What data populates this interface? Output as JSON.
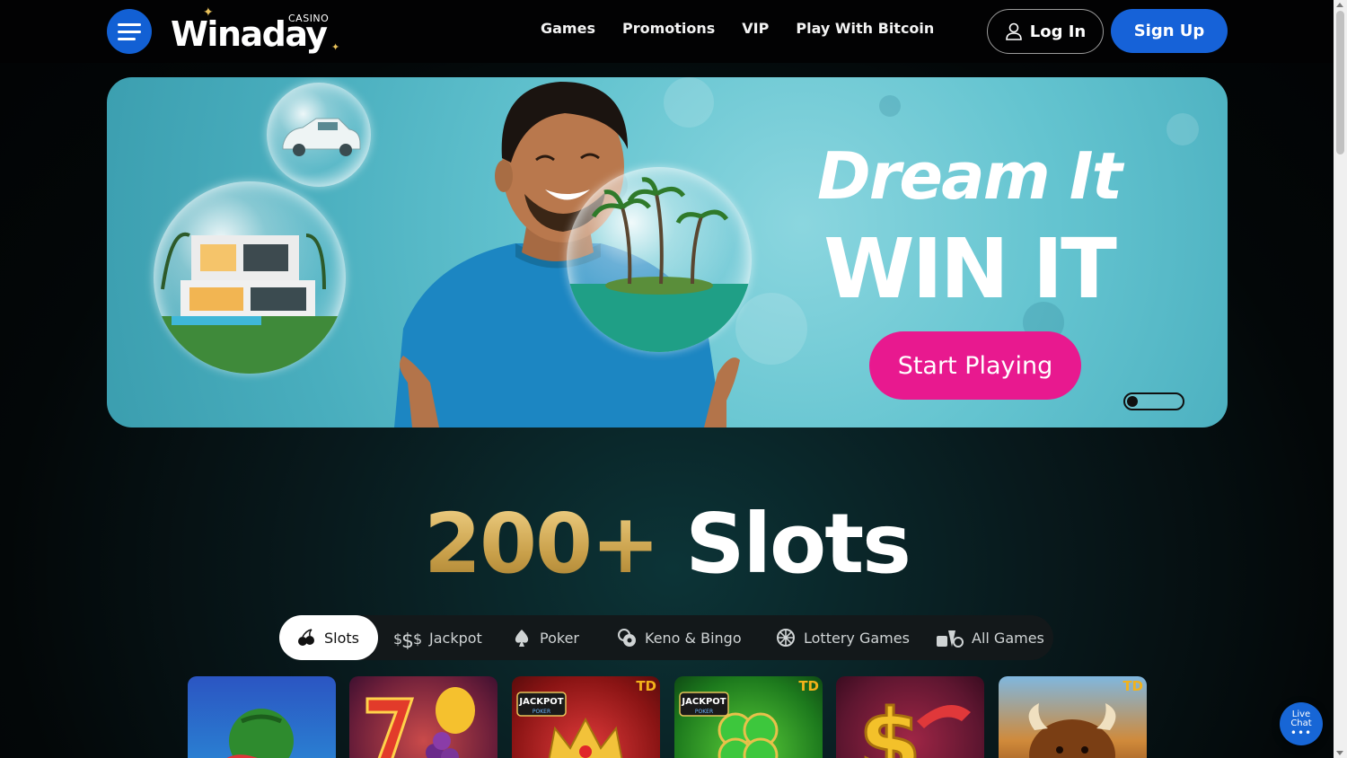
{
  "header": {
    "logo_text": "Winaday",
    "logo_tag": "CASINO",
    "nav": [
      "Games",
      "Promotions",
      "VIP",
      "Play With Bitcoin"
    ],
    "login_label": "Log In",
    "signup_label": "Sign Up"
  },
  "hero": {
    "title_line1": "Dream It",
    "title_line2": "WIN IT",
    "cta_label": "Start Playing"
  },
  "slots": {
    "count": "200+",
    "word": "Slots"
  },
  "tabs": [
    {
      "label": "Slots",
      "icon": "cherries-icon",
      "active": true
    },
    {
      "label": "Jackpot",
      "icon": "dollar-signs-icon",
      "active": false
    },
    {
      "label": "Poker",
      "icon": "spade-icon",
      "active": false
    },
    {
      "label": "Keno & Bingo",
      "icon": "bingo-balls-icon",
      "active": false
    },
    {
      "label": "Lottery Games",
      "icon": "lottery-wheel-icon",
      "active": false
    },
    {
      "label": "All Games",
      "icon": "all-games-icon",
      "active": false
    }
  ],
  "game_tiles": [
    {
      "art": "watermelon",
      "badge": ""
    },
    {
      "art": "lucky-seven-fruits",
      "badge": ""
    },
    {
      "art": "jackpot-poker-crown",
      "badge": "TD"
    },
    {
      "art": "jackpot-poker-clover",
      "badge": "TD"
    },
    {
      "art": "golden-dollar",
      "badge": ""
    },
    {
      "art": "buffalo",
      "badge": "TD"
    }
  ],
  "tile_texts": {
    "jackpot": "JACKPOT",
    "poker": "POKER"
  },
  "livechat": {
    "line1": "Live",
    "line2": "Chat"
  },
  "colors": {
    "accent_blue": "#1662d8",
    "cta_pink": "#e8198f",
    "gold": "#d4ae5c",
    "td_badge": "#f3b21a"
  }
}
